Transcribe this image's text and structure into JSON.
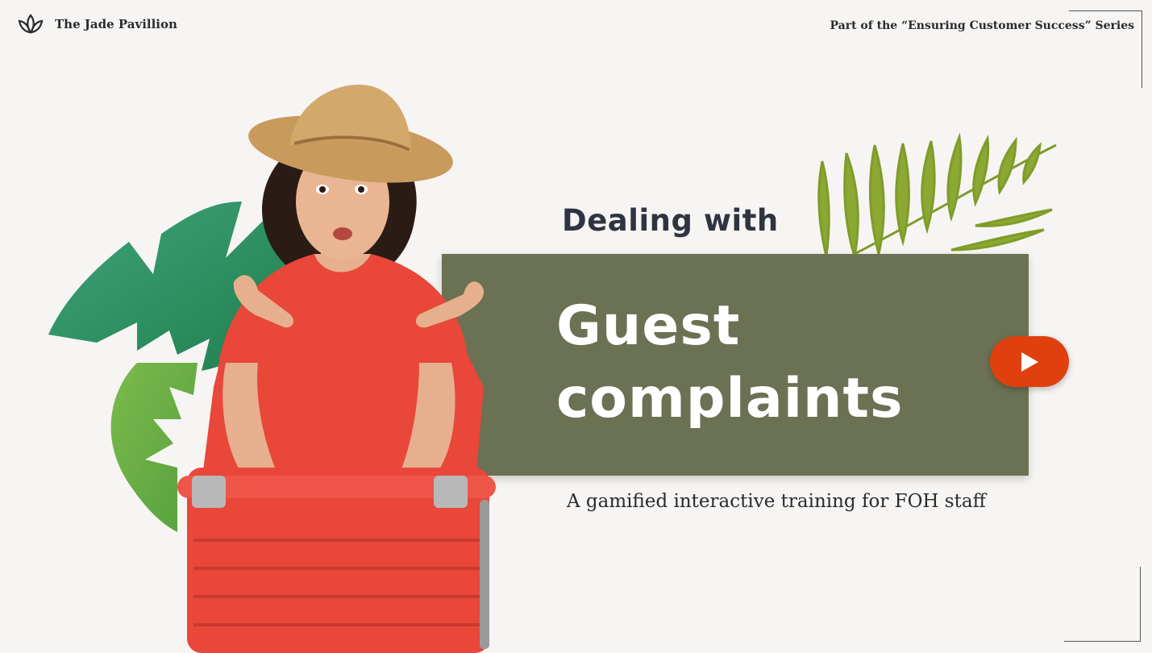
{
  "brand": {
    "name": "The Jade Pavillion",
    "logo_icon": "lotus-icon"
  },
  "series": "Part of the “Ensuring Customer Success” Series",
  "title": {
    "small": "Dealing with",
    "big_line1": "Guest",
    "big_line2": "complaints"
  },
  "subtitle": "A gamified interactive training for FOH staff",
  "play_button": {
    "icon": "play-icon",
    "color": "#e0400e"
  },
  "colors": {
    "panel": "#6b7153",
    "background": "#f7f5f3",
    "leaf_dark": "#2f8f5e",
    "leaf_light": "#6aaa45",
    "palm": "#7f9c2a",
    "shirt": "#e8473a",
    "suitcase": "#e8473a"
  }
}
